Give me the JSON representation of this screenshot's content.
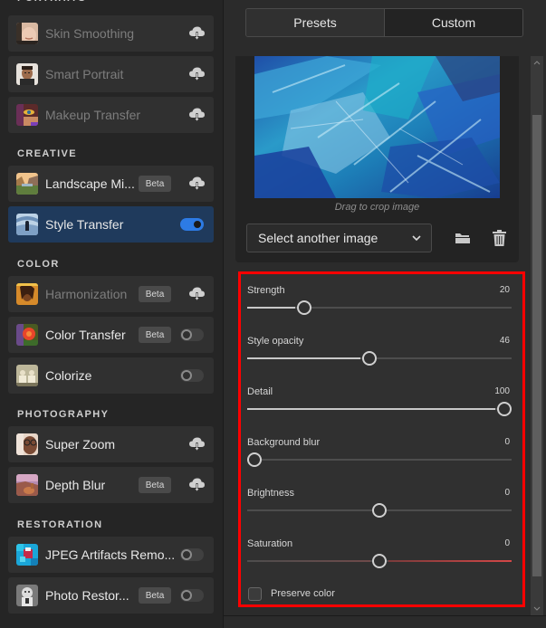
{
  "sidebar": {
    "sections": [
      {
        "title": "PORTRAITS",
        "items": [
          {
            "label": "Skin Smoothing",
            "state": "download",
            "beta": false,
            "disabled": true,
            "thumb": "face-closeup"
          },
          {
            "label": "Smart Portrait",
            "state": "download",
            "beta": false,
            "disabled": true,
            "thumb": "man-portrait"
          },
          {
            "label": "Makeup Transfer",
            "state": "download",
            "beta": false,
            "disabled": true,
            "thumb": "makeup-eye"
          }
        ]
      },
      {
        "title": "CREATIVE",
        "items": [
          {
            "label": "Landscape Mi...",
            "state": "download",
            "beta": true,
            "disabled": false,
            "thumb": "valley-landscape"
          },
          {
            "label": "Style Transfer",
            "state": "toggle-on",
            "beta": false,
            "disabled": false,
            "active": true,
            "thumb": "stylized-figure"
          }
        ]
      },
      {
        "title": "COLOR",
        "items": [
          {
            "label": "Harmonization",
            "state": "download",
            "beta": true,
            "disabled": true,
            "thumb": "woman-warm"
          },
          {
            "label": "Color Transfer",
            "state": "toggle-off",
            "beta": true,
            "disabled": false,
            "thumb": "red-flower"
          },
          {
            "label": "Colorize",
            "state": "toggle-off",
            "beta": false,
            "disabled": false,
            "thumb": "vintage-group"
          }
        ]
      },
      {
        "title": "PHOTOGRAPHY",
        "items": [
          {
            "label": "Super Zoom",
            "state": "download",
            "beta": false,
            "disabled": false,
            "thumb": "man-glasses"
          },
          {
            "label": "Depth Blur",
            "state": "download",
            "beta": true,
            "disabled": false,
            "thumb": "canyon-deer"
          }
        ]
      },
      {
        "title": "RESTORATION",
        "items": [
          {
            "label": "JPEG Artifacts Remo...",
            "state": "toggle-off",
            "beta": false,
            "disabled": false,
            "thumb": "pixel-blue"
          },
          {
            "label": "Photo Restor...",
            "state": "toggle-off",
            "beta": true,
            "disabled": false,
            "thumb": "old-photo"
          }
        ]
      }
    ],
    "beta_label": "Beta"
  },
  "panel": {
    "tabs": [
      {
        "label": "Presets",
        "selected": false
      },
      {
        "label": "Custom",
        "selected": true
      }
    ],
    "crop_hint": "Drag to crop image",
    "select_image_label": "Select another image",
    "icons": {
      "folder": "folder-icon",
      "trash": "trash-icon",
      "chevron": "chevron-down-icon"
    },
    "controls": [
      {
        "label": "Strength",
        "value": 20,
        "min": 0,
        "max": 100,
        "type": "fill"
      },
      {
        "label": "Style opacity",
        "value": 46,
        "min": 0,
        "max": 100,
        "type": "fill"
      },
      {
        "label": "Detail",
        "value": 100,
        "min": 0,
        "max": 100,
        "type": "fill"
      },
      {
        "label": "Background blur",
        "value": 0,
        "min": 0,
        "max": 100,
        "type": "fill"
      },
      {
        "label": "Brightness",
        "value": 0,
        "min": -50,
        "max": 50,
        "type": "center"
      },
      {
        "label": "Saturation",
        "value": 0,
        "min": -50,
        "max": 50,
        "type": "saturation"
      }
    ],
    "preserve_color": {
      "label": "Preserve color",
      "checked": false
    },
    "highlight_color": "#ff0000",
    "accent_color": "#2d7be5"
  }
}
